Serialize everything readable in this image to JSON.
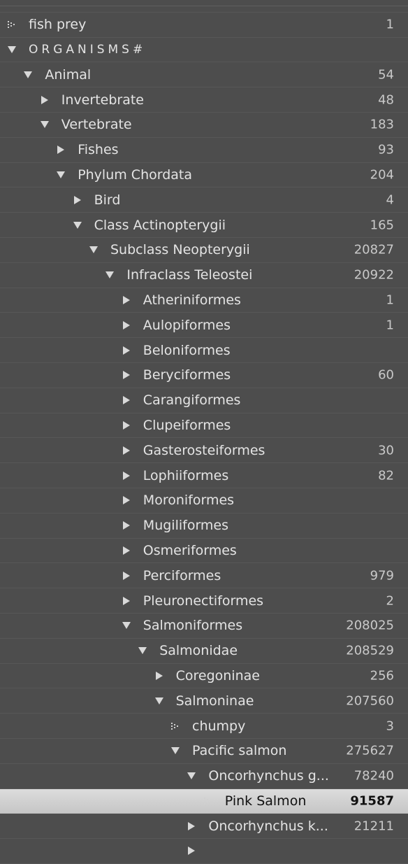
{
  "rows": [
    {
      "label": "",
      "count": "",
      "toggle": "none",
      "level": 0
    },
    {
      "label": "fish prey",
      "count": "1",
      "toggle": "dotted",
      "level": 0
    },
    {
      "label": "ORGANISMS#",
      "count": "",
      "toggle": "open",
      "level": 0,
      "spaced": true
    },
    {
      "label": "Animal",
      "count": "54",
      "toggle": "open",
      "level": 1
    },
    {
      "label": "Invertebrate",
      "count": "48",
      "toggle": "closed",
      "level": 2
    },
    {
      "label": "Vertebrate",
      "count": "183",
      "toggle": "open",
      "level": 2
    },
    {
      "label": "Fishes",
      "count": "93",
      "toggle": "closed",
      "level": 3
    },
    {
      "label": "Phylum Chordata",
      "count": "204",
      "toggle": "open",
      "level": 3
    },
    {
      "label": "Bird",
      "count": "4",
      "toggle": "closed",
      "level": 4
    },
    {
      "label": "Class Actinopterygii",
      "count": "165",
      "toggle": "open",
      "level": 4
    },
    {
      "label": "Subclass Neopterygii",
      "count": "20827",
      "toggle": "open",
      "level": 5
    },
    {
      "label": "Infraclass Teleostei",
      "count": "20922",
      "toggle": "open",
      "level": 6
    },
    {
      "label": "Atheriniformes",
      "count": "1",
      "toggle": "closed",
      "level": 7
    },
    {
      "label": "Aulopiformes",
      "count": "1",
      "toggle": "closed",
      "level": 7
    },
    {
      "label": "Beloniformes",
      "count": "",
      "toggle": "closed",
      "level": 7
    },
    {
      "label": "Beryciformes",
      "count": "60",
      "toggle": "closed",
      "level": 7
    },
    {
      "label": "Carangiformes",
      "count": "",
      "toggle": "closed",
      "level": 7
    },
    {
      "label": "Clupeiformes",
      "count": "",
      "toggle": "closed",
      "level": 7
    },
    {
      "label": "Gasterosteiformes",
      "count": "30",
      "toggle": "closed",
      "level": 7
    },
    {
      "label": "Lophiiformes",
      "count": "82",
      "toggle": "closed",
      "level": 7
    },
    {
      "label": "Moroniformes",
      "count": "",
      "toggle": "closed",
      "level": 7
    },
    {
      "label": "Mugiliformes",
      "count": "",
      "toggle": "closed",
      "level": 7
    },
    {
      "label": "Osmeriformes",
      "count": "",
      "toggle": "closed",
      "level": 7
    },
    {
      "label": "Perciformes",
      "count": "979",
      "toggle": "closed",
      "level": 7
    },
    {
      "label": "Pleuronectiformes",
      "count": "2",
      "toggle": "closed",
      "level": 7
    },
    {
      "label": "Salmoniformes",
      "count": "208025",
      "toggle": "open",
      "level": 7
    },
    {
      "label": "Salmonidae",
      "count": "208529",
      "toggle": "open",
      "level": 8
    },
    {
      "label": "Coregoninae",
      "count": "256",
      "toggle": "closed",
      "level": 9
    },
    {
      "label": "Salmoninae",
      "count": "207560",
      "toggle": "open",
      "level": 9
    },
    {
      "label": "chumpy",
      "count": "3",
      "toggle": "dotted",
      "level": 10
    },
    {
      "label": "Pacific salmon",
      "count": "275627",
      "toggle": "open",
      "level": 10
    },
    {
      "label": "Oncorhynchus g...",
      "count": "78240",
      "toggle": "open",
      "level": 11
    },
    {
      "label": "Pink Salmon",
      "count": "91587",
      "toggle": "dotted",
      "level": 12,
      "selected": true
    },
    {
      "label": "Oncorhynchus k...",
      "count": "21211",
      "toggle": "closed",
      "level": 11
    },
    {
      "label": "",
      "count": "",
      "toggle": "closed",
      "level": 11
    }
  ],
  "colors": {
    "background": "#4d4d4d",
    "text": "#e4e4e4",
    "count": "#c9c9c9",
    "selected_bg": "#d0d0d0",
    "selected_text": "#111111"
  }
}
